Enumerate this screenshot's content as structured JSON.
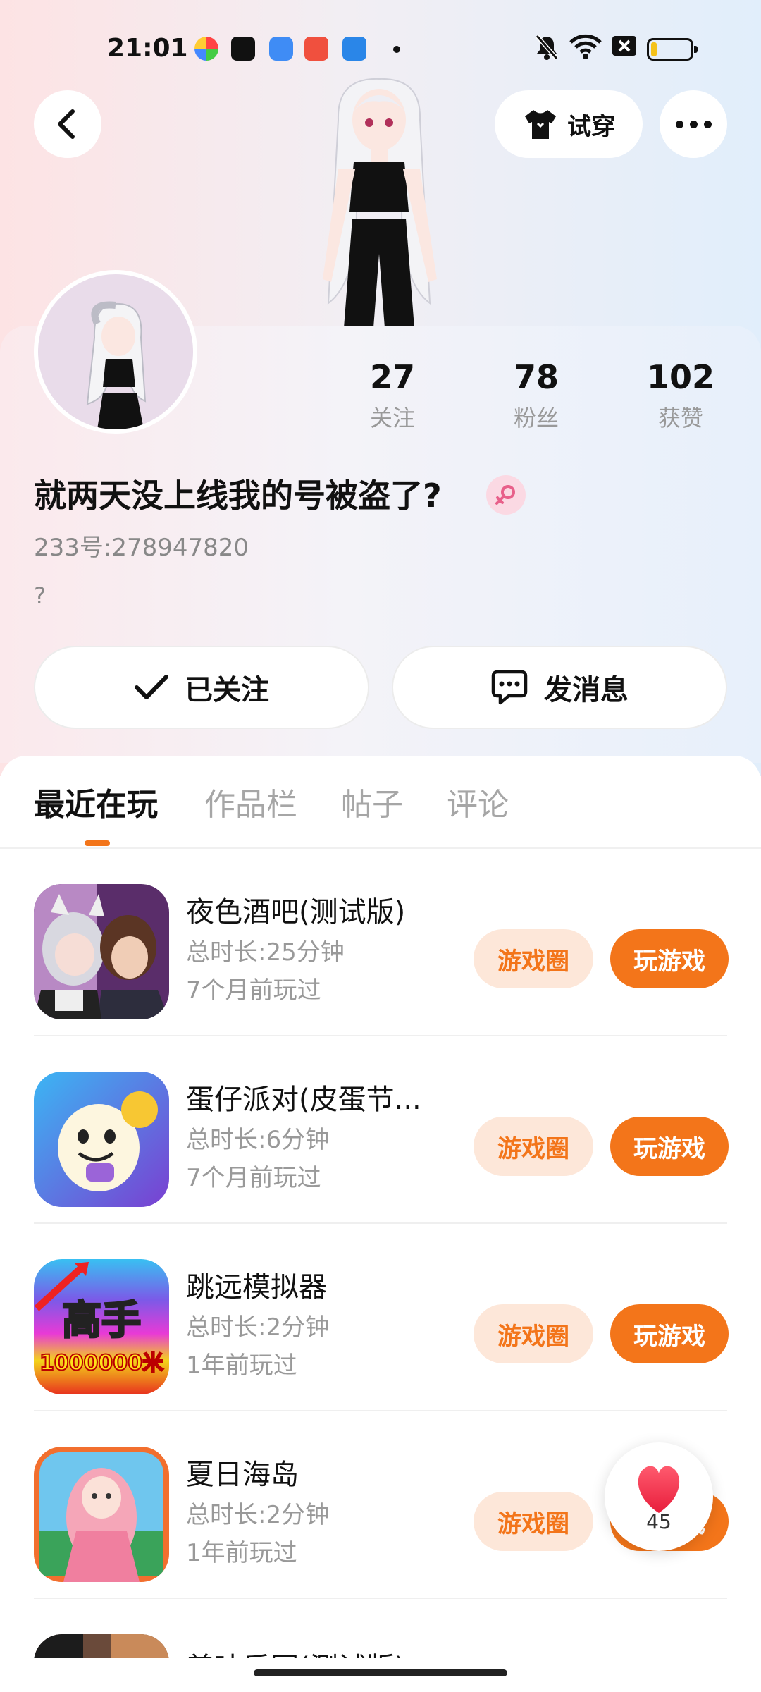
{
  "status_bar": {
    "time": "21:01",
    "app_icons": [
      "multicolor-app-icon",
      "tiktok-icon",
      "blue-app-icon",
      "music-app-icon",
      "blue-arrow-app-icon"
    ],
    "system_icons": [
      "mute-bell-icon",
      "wifi-icon",
      "close-box-icon",
      "battery-icon"
    ],
    "battery_level": 0.15
  },
  "header": {
    "back_icon": "chevron-left-icon",
    "tryon_label": "试穿",
    "more_icon": "more-dots-icon"
  },
  "profile": {
    "nickname": "就两天没上线我的号被盗了?",
    "gender": "female",
    "uid": "233号:278947820",
    "bio": "?",
    "stats": [
      {
        "value": "27",
        "label": "关注"
      },
      {
        "value": "78",
        "label": "粉丝"
      },
      {
        "value": "102",
        "label": "获赞"
      }
    ],
    "follow_label": "已关注",
    "message_label": "发消息"
  },
  "tabs": [
    "最近在玩",
    "作品栏",
    "帖子",
    "评论"
  ],
  "games": [
    {
      "title": "夜色酒吧(测试版)",
      "duration": "总时长:25分钟",
      "last_played": "7个月前玩过",
      "circle_label": "游戏圈",
      "play_label": "玩游戏"
    },
    {
      "title": "蛋仔派对(皮蛋节...",
      "duration": "总时长:6分钟",
      "last_played": "7个月前玩过",
      "circle_label": "游戏圈",
      "play_label": "玩游戏"
    },
    {
      "title": "跳远模拟器",
      "duration": "总时长:2分钟",
      "last_played": "1年前玩过",
      "circle_label": "游戏圈",
      "play_label": "玩游戏",
      "icon_text_1": "高手",
      "icon_text_2": "1000000米"
    },
    {
      "title": "夏日海岛",
      "duration": "总时长:2分钟",
      "last_played": "1年前玩过",
      "circle_label": "游戏圈",
      "play_label": "玩游戏"
    },
    {
      "title": "美味乐园(测试版)"
    }
  ],
  "like_button": {
    "count": "45"
  },
  "colors": {
    "accent": "#f3751a",
    "accent_light": "#fde7d9"
  }
}
